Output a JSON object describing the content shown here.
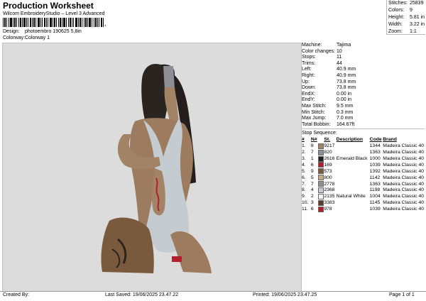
{
  "header": {
    "title": "Production Worksheet",
    "subtitle": "Wilcom EmbroideryStudio – Level 3 Advanced",
    "barcode_suffix": ",",
    "design_label": "Design:",
    "design_value": "photoembro 190625 5,8in",
    "colorway_label": "Colorway:",
    "colorway_value": "Colorway 1"
  },
  "stats": [
    {
      "label": "Stitches:",
      "value": "25839"
    },
    {
      "label": "Colors:",
      "value": "9"
    },
    {
      "label": "Height:",
      "value": "5.81 in"
    },
    {
      "label": "Width:",
      "value": "3.22 in"
    },
    {
      "label": "Zoom:",
      "value": "1:1"
    }
  ],
  "machine_info": [
    {
      "label": "Machine:",
      "value": "Tajima"
    },
    {
      "label": "Color changes:",
      "value": "10"
    },
    {
      "label": "Stops:",
      "value": "11"
    },
    {
      "label": "Trims:",
      "value": "44"
    },
    {
      "label": "Left:",
      "value": "40.9 mm"
    },
    {
      "label": "Right:",
      "value": "40.9 mm"
    },
    {
      "label": "Up:",
      "value": "73.8 mm"
    },
    {
      "label": "Down:",
      "value": "73.8 mm"
    },
    {
      "label": "EndX:",
      "value": "0.00 in"
    },
    {
      "label": "EndY:",
      "value": "0.00 in"
    },
    {
      "label": "Max Stitch:",
      "value": "9.5 mm"
    },
    {
      "label": "Min Stitch:",
      "value": "0.3 mm"
    },
    {
      "label": "Max Jump:",
      "value": "7.0 mm"
    },
    {
      "label": "Total Bobbin:",
      "value": "164.67ft"
    }
  ],
  "stop_sequence": {
    "title": "Stop Sequence:",
    "headers": [
      "#",
      "N#",
      "",
      "St.",
      "Description",
      "Code",
      "Brand"
    ],
    "rows": [
      {
        "n": "1.",
        "needle": "8",
        "color": "#a28366",
        "st": "9217",
        "desc": "",
        "code": "1344",
        "brand": "Madeira Classic 40"
      },
      {
        "n": "2.",
        "needle": "7",
        "color": "#8e8f94",
        "st": "820",
        "desc": "",
        "code": "1363",
        "brand": "Madeira Classic 40"
      },
      {
        "n": "3.",
        "needle": "1",
        "color": "#1f1f1f",
        "st": "2616",
        "desc": "Emerald Black",
        "code": "1000",
        "brand": "Madeira Classic 40"
      },
      {
        "n": "4.",
        "needle": "6",
        "color": "#b0202c",
        "st": "169",
        "desc": "",
        "code": "1039",
        "brand": "Madeira Classic 40"
      },
      {
        "n": "5.",
        "needle": "9",
        "color": "#7a5a3c",
        "st": "573",
        "desc": "",
        "code": "1392",
        "brand": "Madeira Classic 40"
      },
      {
        "n": "6.",
        "needle": "5",
        "color": "#c9a888",
        "st": "800",
        "desc": "",
        "code": "1142",
        "brand": "Madeira Classic 40"
      },
      {
        "n": "7.",
        "needle": "7",
        "color": "#8e8f94",
        "st": "2778",
        "desc": "",
        "code": "1363",
        "brand": "Madeira Classic 40"
      },
      {
        "n": "8.",
        "needle": "4",
        "color": "#c4ccd2",
        "st": "2368",
        "desc": "",
        "code": "1198",
        "brand": "Madeira Classic 40"
      },
      {
        "n": "9.",
        "needle": "2",
        "color": "#f4f3ee",
        "st": "2135",
        "desc": "Natural White",
        "code": "1004",
        "brand": "Madeira Classic 40"
      },
      {
        "n": "10.",
        "needle": "3",
        "color": "#5b3d29",
        "st": "3383",
        "desc": "",
        "code": "1145",
        "brand": "Madeira Classic 40"
      },
      {
        "n": "11.",
        "needle": "6",
        "color": "#b0202c",
        "st": "978",
        "desc": "",
        "code": "1039",
        "brand": "Madeira Classic 40"
      }
    ]
  },
  "footer": {
    "created_by": "Created By:",
    "last_saved": "Last Saved: 19/06/2025 23.47.22",
    "printed": "Printed: 19/06/2025 23.47.25",
    "page": "Page 1 of 1"
  }
}
